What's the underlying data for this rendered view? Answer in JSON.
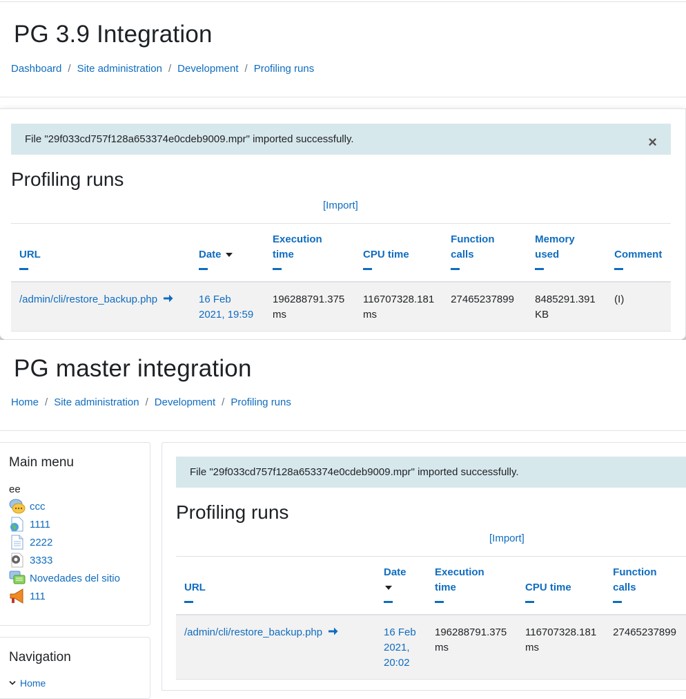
{
  "top": {
    "site_title": "PG 3.9 Integration",
    "breadcrumb": [
      "Dashboard",
      "Site administration",
      "Development",
      "Profiling runs"
    ],
    "alert": "File \"29f033cd757f128a653374e0cdeb9009.mpr\" imported successfully.",
    "close_glyph": "×",
    "heading": "Profiling runs",
    "import_link": "[Import]",
    "columns": {
      "url": "URL",
      "date": "Date",
      "exec1": "Execution",
      "exec2": "time",
      "cpu": "CPU time",
      "func1": "Function",
      "func2": "calls",
      "mem1": "Memory",
      "mem2": "used",
      "comment": "Comment"
    },
    "row": {
      "url": "/admin/cli/restore_backup.php",
      "date1": "16 Feb",
      "date2": "2021, 19:59",
      "exec1": "196288791.375",
      "exec2": "ms",
      "cpu1": "116707328.181",
      "cpu2": "ms",
      "func": "27465237899",
      "mem1": "8485291.391",
      "mem2": "KB",
      "comment": "(I)"
    }
  },
  "bottom": {
    "site_title": "PG master integration",
    "breadcrumb": [
      "Home",
      "Site administration",
      "Development",
      "Profiling runs"
    ],
    "main_menu": {
      "title": "Main menu",
      "plain_item": "ee",
      "items": [
        {
          "label": "ccc",
          "icon": "chat-icon"
        },
        {
          "label": "1111",
          "icon": "url-globe-icon"
        },
        {
          "label": "2222",
          "icon": "page-icon"
        },
        {
          "label": "3333",
          "icon": "settings-gear-icon"
        },
        {
          "label": "Novedades del sitio",
          "icon": "forum-icon"
        },
        {
          "label": "111",
          "icon": "megaphone-icon"
        }
      ]
    },
    "navigation": {
      "title": "Navigation",
      "home": "Home"
    },
    "alert": "File \"29f033cd757f128a653374e0cdeb9009.mpr\" imported successfully.",
    "heading": "Profiling runs",
    "import_link": "[Import]",
    "columns": {
      "url": "URL",
      "date": "Date",
      "exec1": "Execution",
      "exec2": "time",
      "cpu": "CPU time",
      "func1": "Function",
      "func2": "calls"
    },
    "row": {
      "url": "/admin/cli/restore_backup.php",
      "date1": "16 Feb",
      "date2": "2021,",
      "date3": "20:02",
      "exec1": "196288791.375",
      "exec2": "ms",
      "cpu1": "116707328.181",
      "cpu2": "ms",
      "func": "27465237899"
    }
  },
  "colors": {
    "link": "#0f6cbf",
    "alert_bg": "#d7e8ec",
    "row_bg": "#f2f2f2"
  }
}
